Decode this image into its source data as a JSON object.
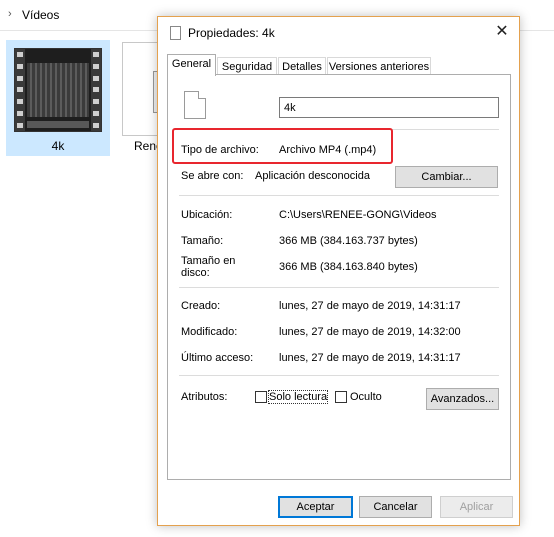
{
  "explorer": {
    "breadcrumb": "Vídeos",
    "files": [
      {
        "name": "4k"
      },
      {
        "name": "Renee"
      }
    ]
  },
  "dialog": {
    "title": "Propiedades: 4k",
    "tabs": [
      "General",
      "Seguridad",
      "Detalles",
      "Versiones anteriores"
    ],
    "active_tab": "General",
    "file_name_value": "4k",
    "rows": {
      "type_label": "Tipo de archivo:",
      "type_value": "Archivo MP4 (.mp4)",
      "opens_label": "Se abre con:",
      "opens_value": "Aplicación desconocida",
      "change_button": "Cambiar...",
      "location_label": "Ubicación:",
      "location_value": "C:\\Users\\RENEE-GONG\\Videos",
      "size_label": "Tamaño:",
      "size_value": "366 MB (384.163.737 bytes)",
      "size_disk_label_1": "Tamaño en",
      "size_disk_label_2": "disco:",
      "size_disk_value": "366 MB (384.163.840 bytes)",
      "created_label": "Creado:",
      "created_value": "lunes, 27 de mayo de 2019, 14:31:17",
      "modified_label": "Modificado:",
      "modified_value": "lunes, 27 de mayo de 2019, 14:32:00",
      "accessed_label": "Último acceso:",
      "accessed_value": "lunes, 27 de mayo de 2019, 14:31:17",
      "attributes_label": "Atributos:",
      "readonly_label": "Solo lectura",
      "hidden_label": "Oculto",
      "advanced_button": "Avanzados..."
    },
    "buttons": {
      "ok": "Aceptar",
      "cancel": "Cancelar",
      "apply": "Aplicar"
    },
    "colors": {
      "highlight": "#e8262e",
      "window_border": "#e4a14e",
      "selection": "#cce8ff"
    }
  }
}
